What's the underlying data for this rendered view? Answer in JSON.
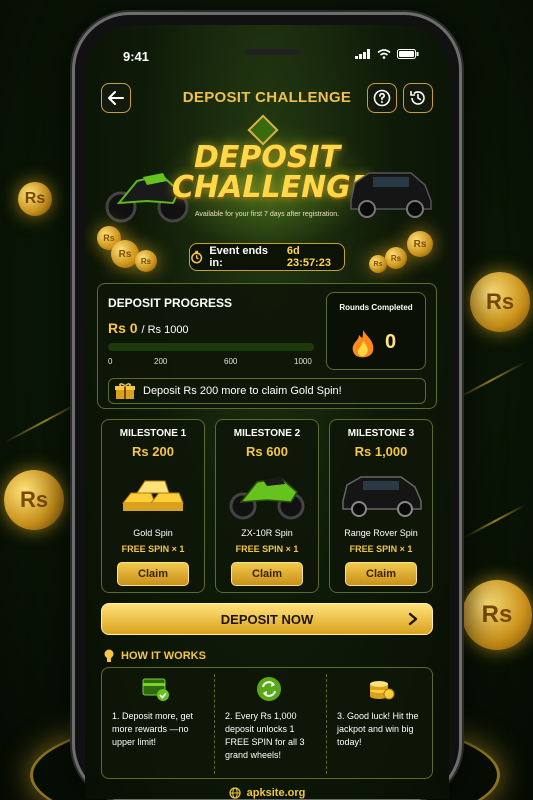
{
  "status_bar": {
    "time": "9:41"
  },
  "header": {
    "title": "DEPOSIT CHALLENGE"
  },
  "hero": {
    "title_line1": "DEPOSIT",
    "title_line2": "CHALLENGE",
    "subtitle": "Available for your first 7 days after registration.",
    "event_label": "Event ends in:",
    "event_value": "6d 23:57:23"
  },
  "progress": {
    "title": "DEPOSIT PROGRESS",
    "current": "Rs 0",
    "target": "/ Rs 1000",
    "fill_fraction": 0.0,
    "ticks": [
      "0",
      "200",
      "600",
      "1000"
    ],
    "rounds_label": "Rounds Completed",
    "rounds_value": "0",
    "note": "Deposit Rs 200 more to claim Gold Spin!"
  },
  "milestones": [
    {
      "title": "MILESTONE 1",
      "amount": "Rs 200",
      "prize": "Gold Spin",
      "spin": "FREE SPIN × 1",
      "button": "Claim"
    },
    {
      "title": "MILESTONE 2",
      "amount": "Rs 600",
      "prize": "ZX-10R Spin",
      "spin": "FREE SPIN × 1",
      "button": "Claim"
    },
    {
      "title": "MILESTONE 3",
      "amount": "Rs 1,000",
      "prize": "Range Rover Spin",
      "spin": "FREE SPIN × 1",
      "button": "Claim"
    }
  ],
  "cta": {
    "label": "DEPOSIT NOW"
  },
  "how_it_works": {
    "heading": "HOW IT WORKS",
    "steps": [
      "1. Deposit more, get more rewards —no upper limit!",
      "2. Every Rs 1,000 deposit unlocks 1 FREE SPIN for all 3 grand wheels!",
      "3. Good luck! Hit the jackpot and win big today!"
    ]
  },
  "footer": {
    "site": "apksite.org"
  },
  "coin_label": "Rs",
  "colors": {
    "accent_gold": "#f5c742",
    "progress_green": "#6ec020",
    "border_olive": "#5a6b2a"
  }
}
